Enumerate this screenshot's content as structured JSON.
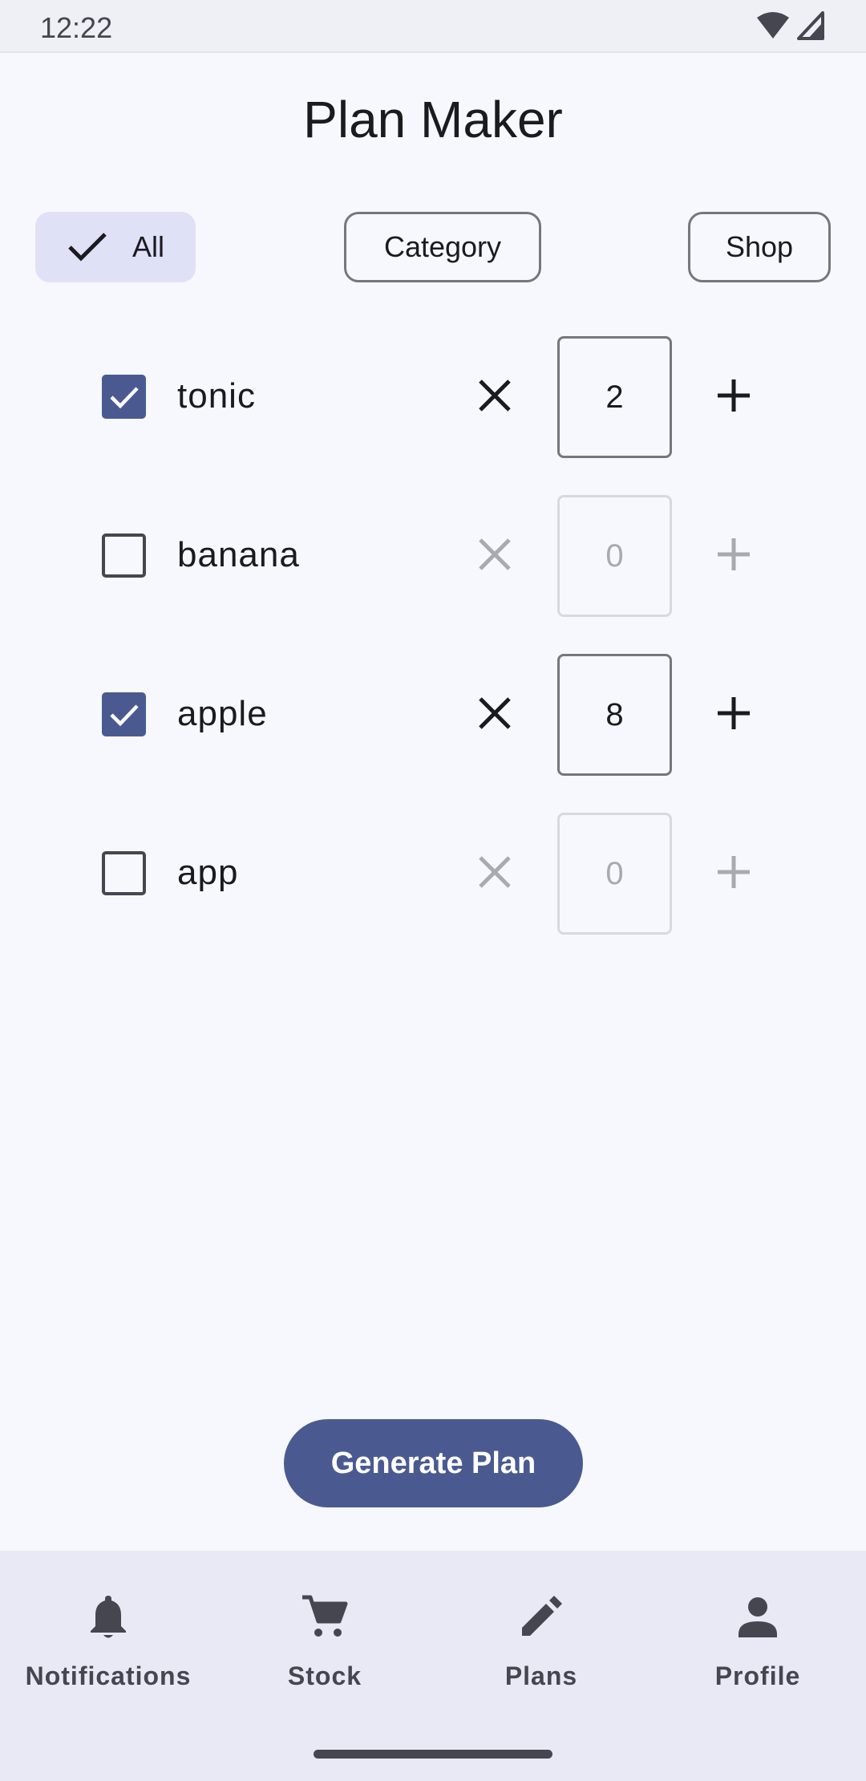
{
  "status_bar": {
    "time": "12:22"
  },
  "header": {
    "title": "Plan Maker"
  },
  "filters": [
    {
      "label": "All",
      "selected": true
    },
    {
      "label": "Category",
      "selected": false
    },
    {
      "label": "Shop",
      "selected": false
    }
  ],
  "items": [
    {
      "name": "tonic",
      "checked": true,
      "quantity": "2"
    },
    {
      "name": "banana",
      "checked": false,
      "quantity": "0"
    },
    {
      "name": "apple",
      "checked": true,
      "quantity": "8"
    },
    {
      "name": "app",
      "checked": false,
      "quantity": "0"
    }
  ],
  "actions": {
    "generate_label": "Generate Plan"
  },
  "bottom_nav": [
    {
      "label": "Notifications",
      "icon": "bell-icon"
    },
    {
      "label": "Stock",
      "icon": "cart-icon"
    },
    {
      "label": "Plans",
      "icon": "pencil-icon"
    },
    {
      "label": "Profile",
      "icon": "person-icon"
    }
  ],
  "colors": {
    "primary": "#4a5a91",
    "chip_selected_bg": "#dfe1f7",
    "background": "#f7f8fd",
    "nav_background": "#e8e9f4"
  }
}
